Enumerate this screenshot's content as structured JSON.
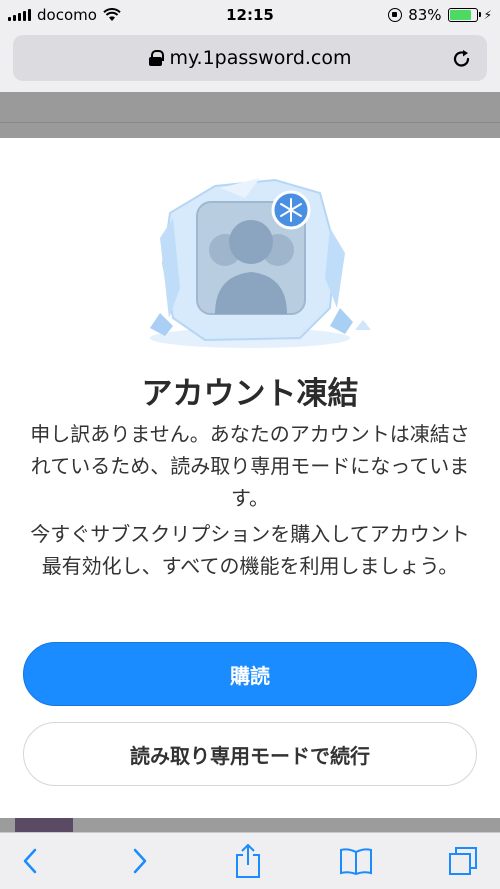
{
  "status_bar": {
    "carrier": "docomo",
    "time": "12:15",
    "battery_percent": "83%",
    "battery_level": 0.83,
    "icons": [
      "signal-bars-icon",
      "wifi-icon",
      "rotation-lock-icon",
      "battery-icon",
      "charging-icon"
    ]
  },
  "browser": {
    "url": "my.1password.com",
    "icons": [
      "lock-icon",
      "reload-icon"
    ]
  },
  "modal": {
    "title": "アカウント凍結",
    "message1": "申し訳ありません。あなたのアカウントは凍結されているため、読み取り専用モードになっています。",
    "message2": "今すぐサブスクリプションを購入してアカウント最有効化し、すべての機能を利用しましょう。",
    "primary_button": "購読",
    "secondary_button": "読み取り専用モードで続行"
  },
  "toolbar": {
    "icons": [
      "back-icon",
      "forward-icon",
      "share-icon",
      "bookmarks-icon",
      "tabs-icon"
    ]
  },
  "colors": {
    "accent": "#1a8cff",
    "ice": "#cfe6fb",
    "status_bg": "#efeff1"
  }
}
